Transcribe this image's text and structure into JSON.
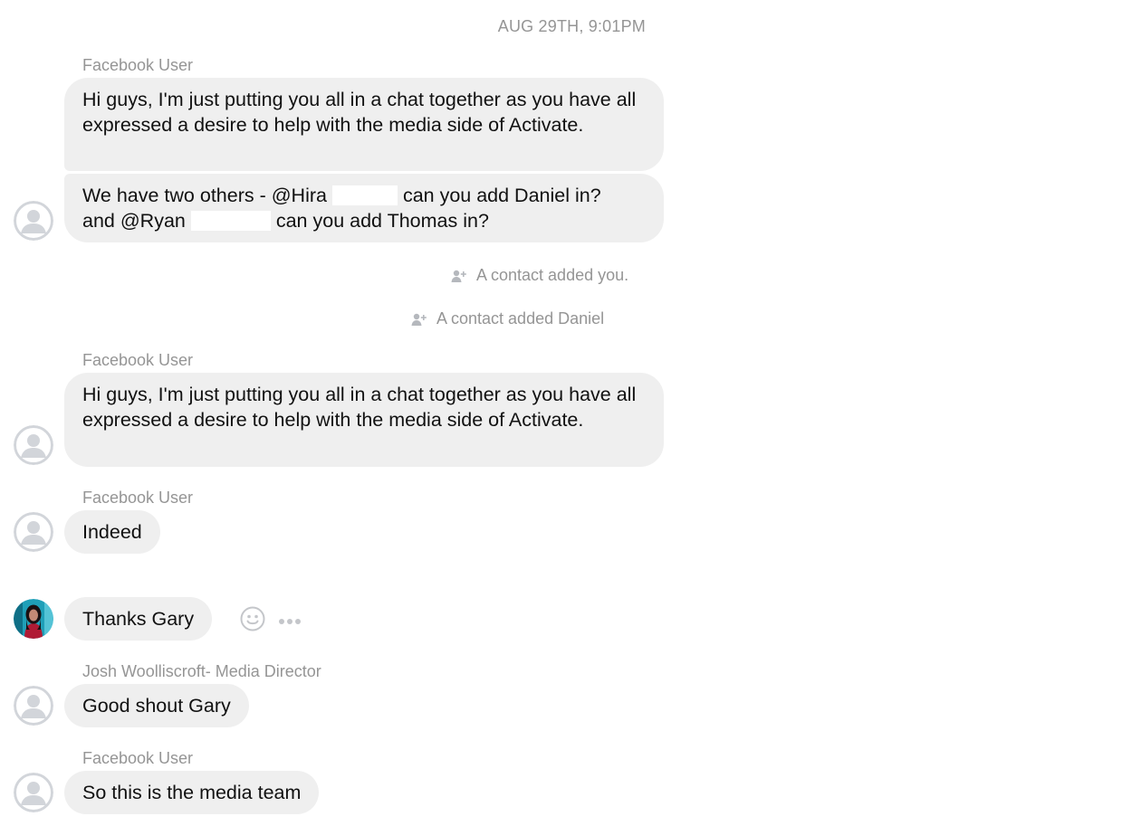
{
  "timestamp": "AUG 29TH, 9:01PM",
  "messages": [
    {
      "sender": "Facebook User",
      "bubble1": "Hi guys, I'm just putting you all in a chat together as you have all expressed a desire to help with the media side of Activate.",
      "bubble2_part1": "We have two others - @Hira",
      "bubble2_part2": "can you add Daniel in?",
      "bubble2_part3": "and @Ryan",
      "bubble2_part4": "can you add Thomas in?"
    },
    {
      "sender": "Facebook User",
      "text": "Hi guys, I'm just putting you all in a chat together as you have all expressed a desire to help with the media side of Activate."
    },
    {
      "sender": "Facebook User",
      "text": "Indeed"
    },
    {
      "text": "Thanks Gary"
    },
    {
      "sender": "Josh Woolliscroft- Media Director",
      "text": "Good shout Gary"
    },
    {
      "sender": "Facebook User",
      "text": "So this is the media team"
    }
  ],
  "system": {
    "added_you": "A contact added you.",
    "added_daniel": "A contact added Daniel"
  },
  "icons": {
    "add_person": "add-person-icon",
    "react": "emoji-reaction-icon",
    "more": "more-options-icon",
    "default_avatar": "default-avatar-icon"
  }
}
